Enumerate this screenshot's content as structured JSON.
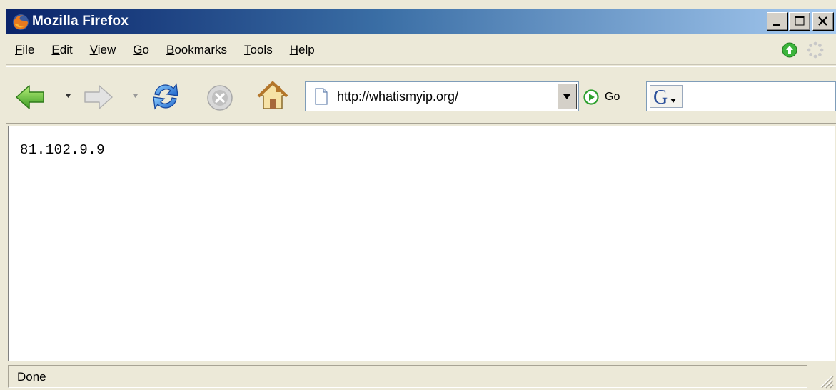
{
  "window": {
    "title": "Mozilla Firefox"
  },
  "menu": {
    "items": [
      {
        "label": "File",
        "accel": "F",
        "rest": "ile"
      },
      {
        "label": "Edit",
        "accel": "E",
        "rest": "dit"
      },
      {
        "label": "View",
        "accel": "V",
        "rest": "iew"
      },
      {
        "label": "Go",
        "accel": "G",
        "rest": "o"
      },
      {
        "label": "Bookmarks",
        "accel": "B",
        "rest": "ookmarks"
      },
      {
        "label": "Tools",
        "accel": "T",
        "rest": "ools"
      },
      {
        "label": "Help",
        "accel": "H",
        "rest": "elp"
      }
    ]
  },
  "toolbar": {
    "url": "http://whatismyip.org/",
    "go_label": "Go",
    "search_value": ""
  },
  "content": {
    "text": "81.102.9.9"
  },
  "status": {
    "text": "Done"
  },
  "icons": {
    "back": "back-arrow-icon",
    "forward": "forward-arrow-icon",
    "reload": "reload-icon",
    "stop": "stop-icon",
    "home": "home-icon",
    "go": "go-icon",
    "search_engine": "google-icon",
    "update": "update-available-icon",
    "throbber": "throbber-icon"
  },
  "colors": {
    "titlebar_start": "#0a246a",
    "titlebar_end": "#a6caf0",
    "chrome": "#ece9d8",
    "accent_green": "#3cb43c"
  }
}
